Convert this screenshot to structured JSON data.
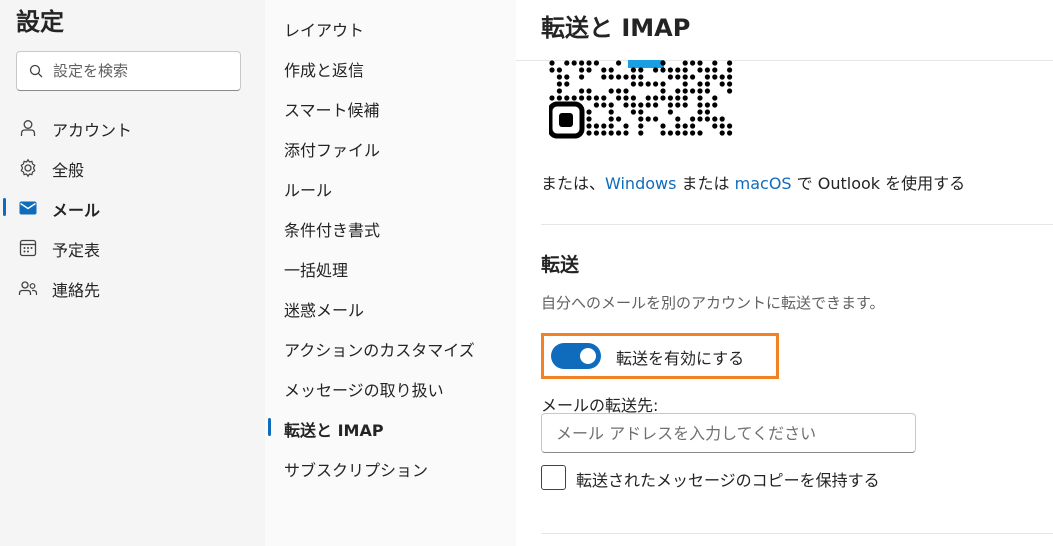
{
  "settings_title": "設定",
  "search": {
    "placeholder": "設定を検索"
  },
  "nav": {
    "items": [
      {
        "label": "アカウント",
        "icon": "person-icon"
      },
      {
        "label": "全般",
        "icon": "gear-icon"
      },
      {
        "label": "メール",
        "icon": "mail-icon",
        "selected": true
      },
      {
        "label": "予定表",
        "icon": "calendar-icon"
      },
      {
        "label": "連絡先",
        "icon": "people-icon"
      }
    ]
  },
  "submenu": {
    "items": [
      {
        "label": "レイアウト"
      },
      {
        "label": "作成と返信"
      },
      {
        "label": "スマート候補"
      },
      {
        "label": "添付ファイル"
      },
      {
        "label": "ルール"
      },
      {
        "label": "条件付き書式"
      },
      {
        "label": "一括処理"
      },
      {
        "label": "迷惑メール"
      },
      {
        "label": "アクションのカスタマイズ"
      },
      {
        "label": "メッセージの取り扱い"
      },
      {
        "label": "転送と IMAP",
        "selected": true
      },
      {
        "label": "サブスクリプション"
      }
    ]
  },
  "content": {
    "title": "転送と IMAP",
    "outlook_line": {
      "prefix": "または、",
      "link_windows": "Windows",
      "middle": " または ",
      "link_macos": "macOS",
      "suffix": " で Outlook を使用する"
    },
    "forwarding": {
      "heading": "転送",
      "description": "自分へのメールを別のアカウントに転送できます。",
      "toggle_label": "転送を有効にする",
      "toggle_on": true,
      "forward_to_label": "メールの転送先:",
      "email_placeholder": "メール アドレスを入力してください",
      "email_value": "",
      "keep_copy_label": "転送されたメッセージのコピーを保持する",
      "keep_copy_checked": false
    }
  },
  "colors": {
    "accent": "#0f6cbd",
    "highlight": "#f48024",
    "nav_bg": "#f5f5f5",
    "submenu_bg": "#fafafa"
  }
}
